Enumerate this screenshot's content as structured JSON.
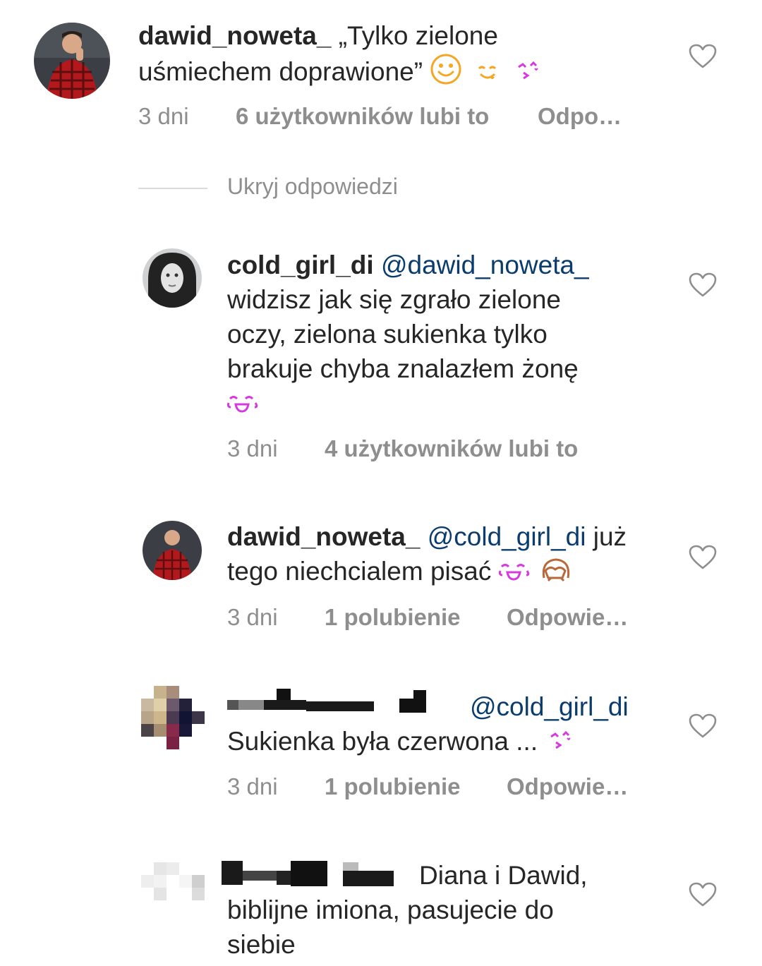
{
  "comments": [
    {
      "username": "dawid_noweta_",
      "line1": "„Tylko zielone",
      "line2": "uśmiechem doprawione”",
      "emojis": [
        "smiling-face-emoji",
        "face-savoring-food-emoji",
        "face-blowing-kiss-emoji"
      ],
      "time": "3 dni",
      "likes": "6 użytkowników lubi to",
      "reply": "Odpo…"
    }
  ],
  "hide_replies": "Ukryj odpowiedzi",
  "replies": [
    {
      "username": "cold_girl_di",
      "mention": "@dawid_noweta_",
      "lines": [
        "widzisz jak się zgrało zielone",
        "oczy,  zielona sukienka tylko",
        "brakuje chyba znalazłem żonę"
      ],
      "emojis": [
        "face-with-tears-of-joy-emoji"
      ],
      "time": "3 dni",
      "likes": "4 użytkowników lubi to"
    },
    {
      "username": "dawid_noweta_",
      "mention": "@cold_girl_di",
      "after_mention": "już",
      "line2": "tego niechcialem pisać",
      "emojis": [
        "face-with-tears-of-joy-emoji",
        "see-no-evil-monkey-emoji"
      ],
      "time": "3 dni",
      "likes": "1 polubienie",
      "reply": "Odpowie…"
    },
    {
      "username": "",
      "mention": "@cold_girl_di",
      "line2": "Sukienka była czerwona ...",
      "emojis": [
        "face-blowing-kiss-emoji"
      ],
      "time": "3 dni",
      "likes": "1 polubienie",
      "reply": "Odpowie…"
    },
    {
      "username": "",
      "lines": [
        "Diana i Dawid,",
        "biblijne imiona, pasujecie do",
        "siebie"
      ]
    }
  ],
  "colors": {
    "text": "#262626",
    "meta": "#8e8e8e",
    "mention": "#0a3c6e",
    "divider": "#dbdbdb",
    "emoji_purple": "#d63adf",
    "emoji_orange": "#f5a623"
  }
}
